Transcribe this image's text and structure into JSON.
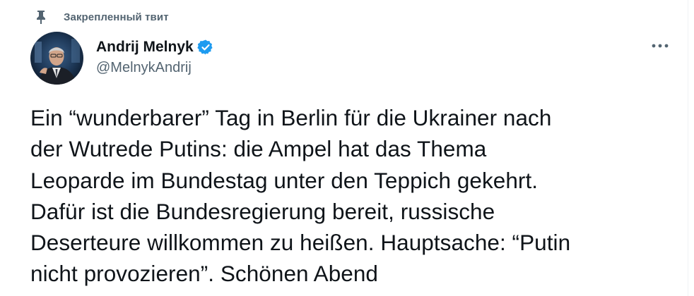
{
  "pinned": {
    "label": "Закрепленный твит",
    "icon": "pin-icon"
  },
  "author": {
    "display_name": "Andrij Melnyk",
    "handle": "@MelnykAndrij",
    "verified": true,
    "verified_icon": "verified-badge-icon",
    "avatar_icon": "avatar"
  },
  "actions": {
    "more_icon": "more-icon"
  },
  "tweet": {
    "lines": [
      "Ein “wunderbarer” Tag in Berlin für die Ukrainer nach",
      "der Wutrede Putins: die Ampel hat das Thema",
      "Leoparde im Bundestag unter den Teppich gekehrt.",
      "Dafür ist die Bundesregierung bereit, russische",
      "Deserteure willkommen zu heißen. Hauptsache: “Putin",
      "nicht provozieren”. Schönen Abend"
    ]
  },
  "colors": {
    "text_primary": "#0f1419",
    "text_secondary": "#536471",
    "verified_blue": "#1d9bf0",
    "background": "#ffffff"
  }
}
